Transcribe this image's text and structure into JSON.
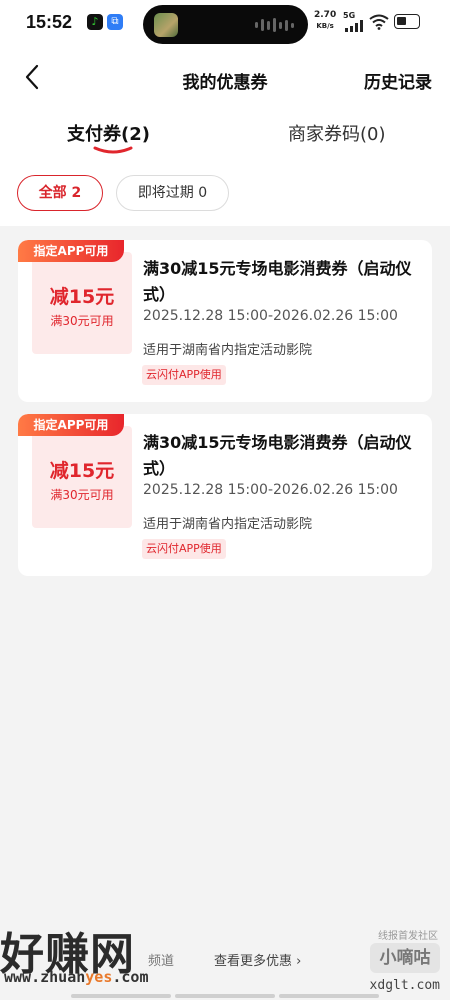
{
  "status_bar": {
    "time": "15:52",
    "net_speed_value": "2.70",
    "net_speed_unit": "KB/s",
    "network": "5G",
    "icons": [
      "music-app-icon",
      "screen-record-icon",
      "signal-icon",
      "wifi-icon",
      "battery-icon"
    ]
  },
  "header": {
    "title": "我的优惠券",
    "history": "历史记录"
  },
  "tabs": [
    {
      "label": "支付券(2)",
      "active": true
    },
    {
      "label": "商家券码(0)",
      "active": false
    }
  ],
  "filters": [
    {
      "label": "全部 2",
      "active": true
    },
    {
      "label": "即将过期 0",
      "active": false
    }
  ],
  "coupons": [
    {
      "tag": "指定APP可用",
      "amount": "减15元",
      "condition": "满30元可用",
      "title": "满30减15元专场电影消费券（启动仪式）",
      "validity": "2025.12.28 15:00-2026.02.26 15:00",
      "scope": "适用于湖南省内指定活动影院",
      "badge": "云闪付APP使用"
    },
    {
      "tag": "指定APP可用",
      "amount": "减15元",
      "condition": "满30元可用",
      "title": "满30减15元专场电影消费券（启动仪式）",
      "validity": "2025.12.28 15:00-2026.02.26 15:00",
      "scope": "适用于湖南省内指定活动影院",
      "badge": "云闪付APP使用"
    }
  ],
  "footer": {
    "partial_text": "频道",
    "more_link": "查看更多优惠",
    "watermark_logo": "好赚网",
    "watermark_url_prefix": "www.zhuan",
    "watermark_url_accent": "yes",
    "watermark_url_suffix": ".com",
    "watermark_tag": "线报首发社区",
    "watermark_badge": "小嘀咕",
    "watermark_domain": "xdglt.com"
  },
  "colors": {
    "accent_red": "#e0262d",
    "tag_gradient_start": "#ff7a45",
    "tag_gradient_end": "#e8262c",
    "coupon_left_bg": "#fdeaea",
    "page_bg": "#f3f3f3"
  }
}
